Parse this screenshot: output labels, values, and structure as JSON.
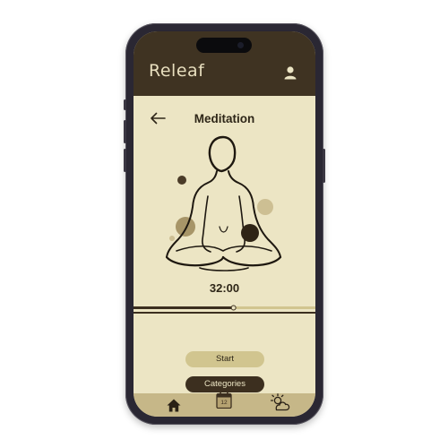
{
  "app": {
    "name": "Releaf"
  },
  "page": {
    "title": "Meditation"
  },
  "session": {
    "timer": "32:00",
    "progress_fraction": 0.55
  },
  "actions": {
    "start_label": "Start",
    "categories_label": "Categories"
  },
  "icons": {
    "profile": "user-icon",
    "back": "arrow-left-icon",
    "home": "home-icon",
    "calendar": "calendar-icon",
    "weather": "sun-cloud-icon"
  },
  "navbar": {
    "calendar_day": "12"
  },
  "colors": {
    "header": "#3f3322",
    "background": "#ece5c4",
    "accent_light": "#d1c58f",
    "accent_dark": "#3c2f1f",
    "navbar": "#c6b788"
  }
}
